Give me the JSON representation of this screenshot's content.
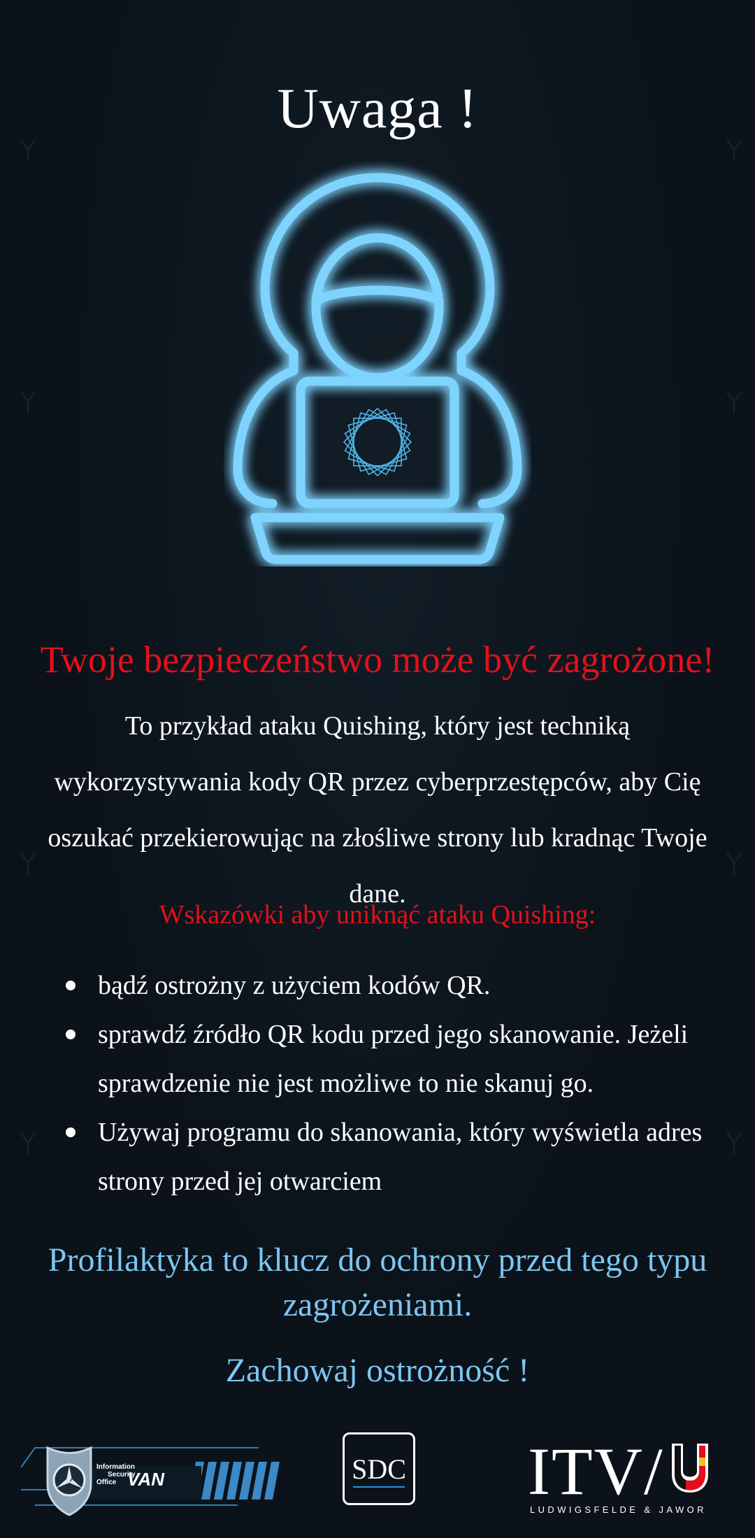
{
  "title": "Uwaga !",
  "headline": "Twoje bezpieczeństwo może być zagrożone!",
  "description": "To przykład ataku Quishing, który jest techniką wykorzystywania kody QR przez cyberprzestępców, aby Cię oszukać przekierowując na złośliwe strony lub kradnąc Twoje dane.",
  "tips_title": "Wskazówki aby uniknąć ataku Quishing:",
  "tips": [
    "bądź ostrożny z użyciem kodów QR.",
    "sprawdź źródło QR kodu przed jego skanowanie. Jeżeli sprawdzenie nie jest możliwe to nie skanuj go.",
    "Używaj programu do skanowania, który wyświetla adres strony przed jej otwarciem"
  ],
  "closing": "Profilaktyka to klucz do ochrony przed tego typu zagrożeniami.",
  "closing2": "Zachowaj ostrożność !",
  "footer": {
    "van_logo_lines": [
      "Information",
      "Security",
      "Office"
    ],
    "van_logo_name": "VAN",
    "sdc_logo": "SDC",
    "itv_logo": "ITV/",
    "itv_subtitle": "LUDWIGSFELDE & JAWOR"
  },
  "colors": {
    "background": "#0b1219",
    "alert_red": "#e3101b",
    "accent_blue": "#7cc6f0",
    "neon_blue": "#5ec3f5"
  },
  "icons": {
    "hero": "hooded-hacker-laptop-icon"
  }
}
